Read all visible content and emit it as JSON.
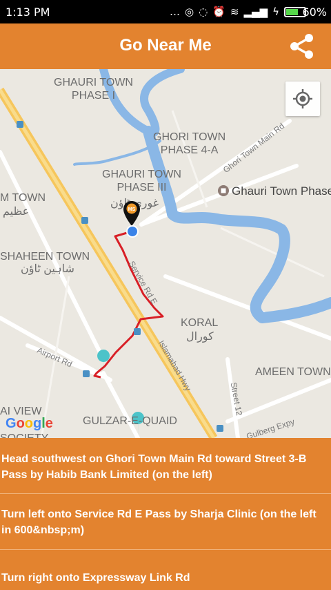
{
  "status_bar": {
    "time": "1:13 PM",
    "icons": "…",
    "battery_percent": "60%"
  },
  "app_bar": {
    "title": "Go Near Me",
    "share_icon": "share-icon"
  },
  "map": {
    "labels": {
      "ghauri_town_phase_1": "GHAURI TOWN\nPHASE I",
      "ghori_town_phase_4a": "GHORI TOWN\nPHASE 4-A",
      "ghauri_town_phase_3": "GHAURI TOWN\nPHASE III",
      "ghauri_urdu": "غوری ٹاؤن",
      "m_town": "M TOWN",
      "m_town_urdu": "عظیم",
      "shaheen_town": "SHAHEEN TOWN",
      "shaheen_urdu": "شاہین ٹاؤن",
      "koral": "KORAL",
      "koral_urdu": "کورال",
      "ameen_town": "AMEEN TOWN",
      "gulzar_e_quaid": "GULZAR-E-QUAID",
      "ai_view": "AI VIEW",
      "society": "SOCIETY",
      "service_rd": "Service Rd E",
      "islamabad_hwy": "Islamabad Hwy",
      "airport_rd": "Airport Rd",
      "street_12": "Street 12",
      "gulberg_expy": "Gulberg Expy",
      "ghori_town_main_rd": "Ghori Town Main Rd"
    },
    "poi": "Ghauri Town Phase",
    "marker_label": "MS",
    "google": "Google",
    "locate_icon": "my-location-icon"
  },
  "directions": [
    {
      "text": "Head southwest on Ghori Town Main Rd toward Street 3-B Pass by Habib Bank Limited (on the left)"
    },
    {
      "text": "Turn left onto Service Rd E Pass by Sharja Clinic (on the left in 600&nbsp;m)"
    },
    {
      "text": "Turn right onto Expressway Link Rd"
    }
  ],
  "colors": {
    "accent": "#e3832f",
    "route": "#d81f26",
    "water": "#8ab7e6",
    "map_bg": "#ebe8e1"
  }
}
